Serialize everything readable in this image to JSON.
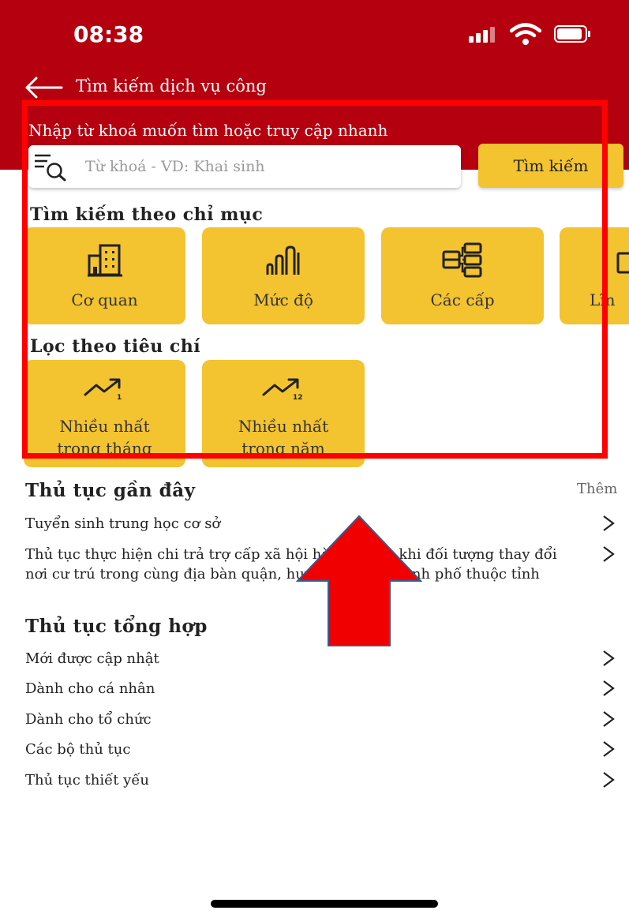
{
  "status_bar": {
    "time": "08:38"
  },
  "header": {
    "title": "Tìm kiếm dịch vụ công",
    "search_hint": "Nhập từ khoá muốn tìm hoặc truy cập nhanh",
    "search_placeholder": "Từ khoá - VD: Khai sinh",
    "search_button": "Tìm kiếm"
  },
  "index_section": {
    "title": "Tìm kiếm theo chỉ mục",
    "tiles": [
      {
        "label": "Cơ quan",
        "icon": "building-icon"
      },
      {
        "label": "Mức độ",
        "icon": "bar-level-icon"
      },
      {
        "label": "Các cấp",
        "icon": "hierarchy-icon"
      },
      {
        "label": "Lĩn",
        "icon": "field-icon"
      }
    ]
  },
  "filter_section": {
    "title": "Lọc theo tiêu chí",
    "tiles": [
      {
        "line1": "Nhiều nhất",
        "line2": "trong tháng",
        "icon": "trend-1-icon",
        "badge": "1"
      },
      {
        "line1": "Nhiều nhất",
        "line2": "trong năm",
        "icon": "trend-12-icon",
        "badge": "12"
      }
    ]
  },
  "recent": {
    "title": "Thủ tục gần đây",
    "more": "Thêm",
    "items": [
      "Tuyển sinh trung học cơ sở",
      "Thủ tục thực hiện chi trả trợ cấp xã hội hàng tháng khi đối tượng thay đổi nơi cư trú trong cùng địa bàn quận, huyện, thị xã, thành phố thuộc tỉnh"
    ]
  },
  "general": {
    "title": "Thủ tục tổng hợp",
    "items": [
      "Mới được cập nhật",
      "Dành cho cá nhân",
      "Dành cho tổ chức",
      "Các bộ thủ tục",
      "Thủ tục thiết yếu"
    ]
  },
  "colors": {
    "header": "#b5000f",
    "tile": "#f3c330",
    "annotation": "#ff0000"
  }
}
